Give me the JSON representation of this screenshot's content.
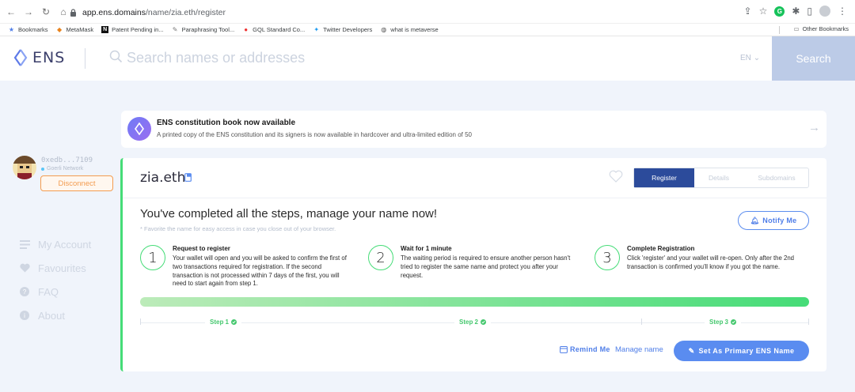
{
  "browser": {
    "url_host": "app.ens.domains",
    "url_path": "/name/zia.eth/register",
    "bookmarks": [
      {
        "label": "Bookmarks",
        "icon": "star-icon"
      },
      {
        "label": "MetaMask",
        "icon": "metamask-icon"
      },
      {
        "label": "Patent Pending in...",
        "icon": "notion-icon"
      },
      {
        "label": "Paraphrasing Tool...",
        "icon": "quill-icon"
      },
      {
        "label": "GQL Standard Co...",
        "icon": "gql-icon"
      },
      {
        "label": "Twitter Developers",
        "icon": "twitter-icon"
      },
      {
        "label": "what is metaverse",
        "icon": "globe-icon"
      }
    ],
    "other_bookmarks": "Other Bookmarks"
  },
  "header": {
    "logo_text": "ENS",
    "search_placeholder": "Search names or addresses",
    "language": "EN",
    "search_label": "Search"
  },
  "banner": {
    "title": "ENS constitution book now available",
    "text": "A printed copy of the ENS constitution and its signers is now available in hardcover and ultra-limited edition of 50"
  },
  "account": {
    "address": "0xedb...7109",
    "network": "Goerli Network",
    "disconnect_label": "Disconnect"
  },
  "sidebar": {
    "items": [
      {
        "label": "My Account",
        "icon": "list-icon"
      },
      {
        "label": "Favourites",
        "icon": "heart-icon"
      },
      {
        "label": "FAQ",
        "icon": "question-icon"
      },
      {
        "label": "About",
        "icon": "info-icon"
      }
    ]
  },
  "name_card": {
    "domain": "zia.eth",
    "tabs": [
      {
        "label": "Register",
        "active": true
      },
      {
        "label": "Details",
        "active": false
      },
      {
        "label": "Subdomains",
        "active": false
      }
    ],
    "complete_title": "You've completed all the steps, manage your name now!",
    "complete_subtitle": "* Favorite the name for easy access in case you close out of your browser.",
    "notify_label": "Notify Me",
    "steps": [
      {
        "number": "1",
        "title": "Request to register",
        "body": "Your wallet will open and you will be asked to confirm the first of two transactions required for registration. If the second transaction is not processed within 7 days of the first, you will need to start again from step 1."
      },
      {
        "number": "2",
        "title": "Wait for 1 minute",
        "body": "The waiting period is required to ensure another person hasn't tried to register the same name and protect you after your request."
      },
      {
        "number": "3",
        "title": "Complete Registration",
        "body": "Click 'register' and your wallet will re-open. Only after the 2nd transaction is confirmed you'll know if you got the name."
      }
    ],
    "progress": 1.0,
    "step_labels": [
      "Step 1",
      "Step 2",
      "Step 3"
    ],
    "remind_label": "Remind Me",
    "manage_label": "Manage name",
    "primary_label": "Set As Primary ENS Name"
  },
  "colors": {
    "accent_blue": "#5a8cf0",
    "tab_active": "#2c4b9b",
    "success_green": "#45dc77",
    "disconnect_orange": "#f39c50"
  }
}
